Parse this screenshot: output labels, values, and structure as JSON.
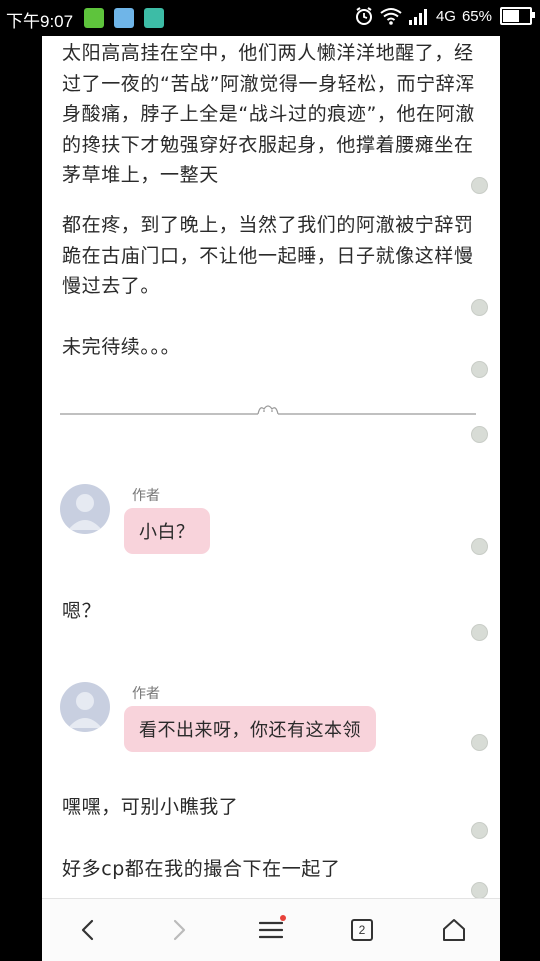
{
  "status_bar": {
    "time": "下午9:07",
    "network": "4G",
    "battery": "65%",
    "battery_level": 0.65,
    "notification_icons": [
      "android-icon",
      "weather-icon",
      "scan-icon"
    ]
  },
  "story": {
    "paragraphs": [
      "太阳高高挂在空中，他们两人懒洋洋地醒了，经过了一夜的“苦战”阿澈觉得一身轻松，而宁辞浑身酸痛，脖子上全是“战斗过的痕迹”，他在阿澈的搀扶下才勉强穿好衣服起身，他撑着腰瘫坐在茅草堆上，一整天",
      "都在疼，到了晚上，当然了我们的阿澈被宁辞罚跪在古庙门口，不让他一起睡，日子就像这样慢慢过去了。",
      "未完待续。。。"
    ]
  },
  "chat": [
    {
      "author": "作者",
      "message": "小白？"
    },
    {
      "author": "作者",
      "message": "看不出来呀，你还有这本领"
    }
  ],
  "replies": [
    "嗯？",
    "嘿嘿，可别小瞧我了",
    "好多cp都在我的撮合下在一起了"
  ],
  "bottom_nav": {
    "tab_count": "2",
    "menu_has_notification": true
  },
  "colors": {
    "bubble": "#f8d3db",
    "page_bg": "#ffffff",
    "notification_dot": "#e8413a"
  }
}
